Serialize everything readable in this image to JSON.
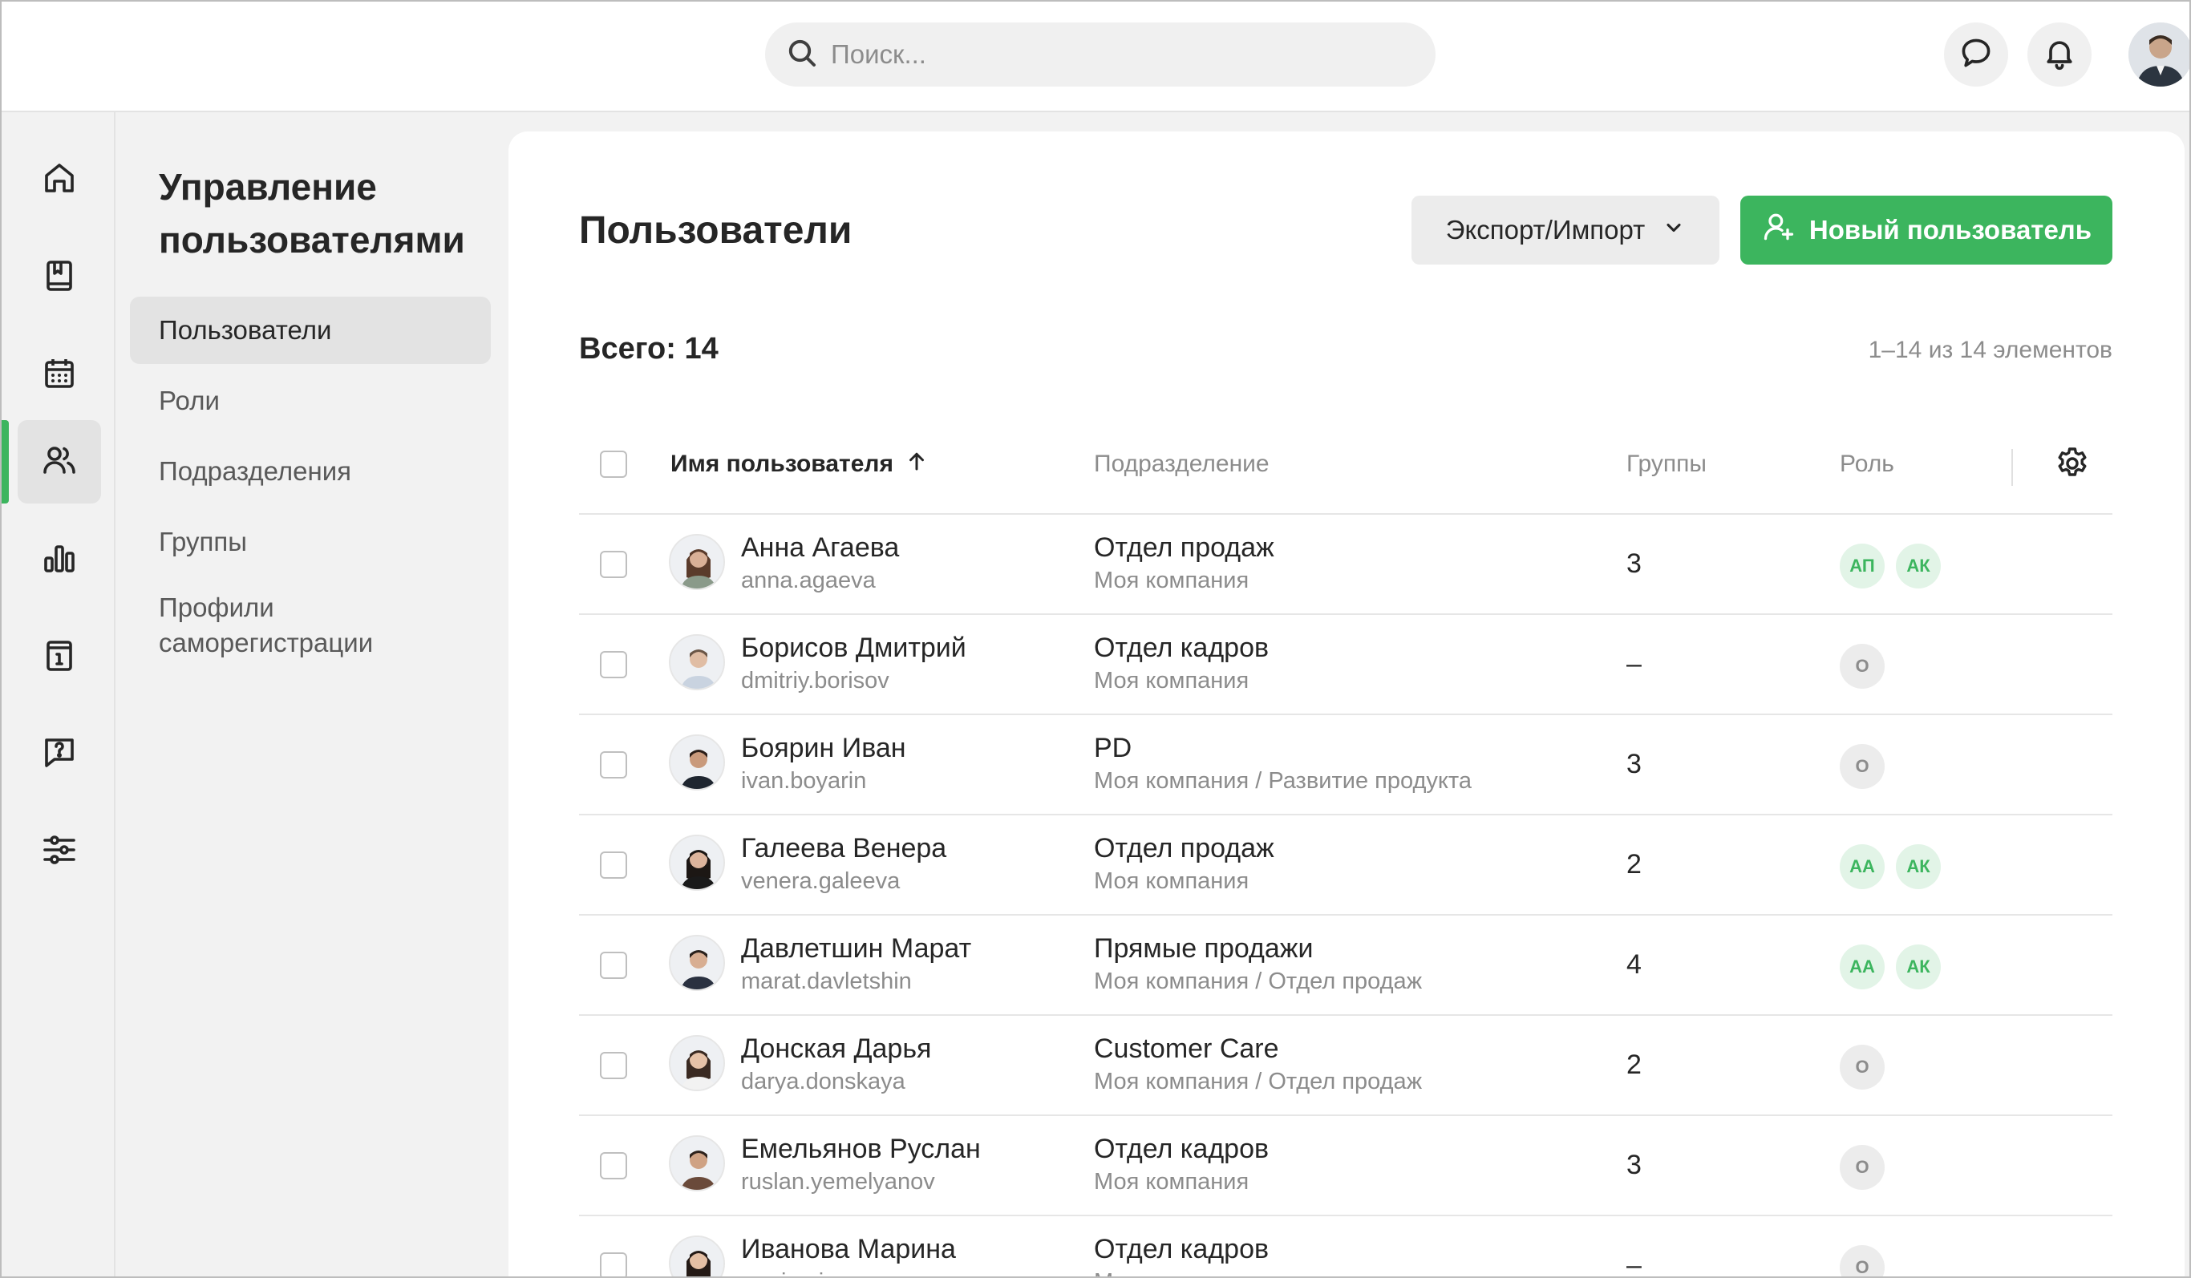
{
  "search": {
    "placeholder": "Поиск..."
  },
  "sidebar": {
    "title": "Управление пользователями",
    "items": [
      {
        "label": "Пользователи",
        "active": true
      },
      {
        "label": "Роли",
        "active": false
      },
      {
        "label": "Подразделения",
        "active": false
      },
      {
        "label": "Группы",
        "active": false
      },
      {
        "label": "Профили саморегистрации",
        "active": false
      }
    ]
  },
  "rail": {
    "icons": [
      "home-icon",
      "book-icon",
      "calendar-icon",
      "users-icon",
      "bar-chart-icon",
      "info-icon",
      "help-message-icon",
      "sliders-icon"
    ],
    "active": "users-icon"
  },
  "main": {
    "title": "Пользователи",
    "export_label": "Экспорт/Импорт",
    "new_user_label": "Новый пользователь",
    "total": "Всего: 14",
    "range": "1–14 из 14 элементов",
    "columns": {
      "name": "Имя пользователя",
      "department": "Подразделение",
      "groups": "Группы",
      "role": "Роль"
    }
  },
  "users": [
    {
      "name": "Анна Агаева",
      "login": "anna.agaeva",
      "dept": "Отдел продаж",
      "path": "Моя компания",
      "groups": "3",
      "roles": [
        "АП",
        "АК"
      ]
    },
    {
      "name": "Борисов Дмитрий",
      "login": "dmitriy.borisov",
      "dept": "Отдел кадров",
      "path": "Моя компания",
      "groups": "–",
      "roles": [
        "О"
      ]
    },
    {
      "name": "Боярин Иван",
      "login": "ivan.boyarin",
      "dept": "PD",
      "path": "Моя компания / Развитие продукта",
      "groups": "3",
      "roles": [
        "О"
      ]
    },
    {
      "name": "Галеева Венера",
      "login": "venera.galeeva",
      "dept": "Отдел продаж",
      "path": "Моя компания",
      "groups": "2",
      "roles": [
        "АА",
        "АК"
      ]
    },
    {
      "name": "Давлетшин Марат",
      "login": "marat.davletshin",
      "dept": "Прямые продажи",
      "path": "Моя компания / Отдел продаж",
      "groups": "4",
      "roles": [
        "АА",
        "АК"
      ]
    },
    {
      "name": "Донская Дарья",
      "login": "darya.donskaya",
      "dept": "Customer Care",
      "path": "Моя компания / Отдел продаж",
      "groups": "2",
      "roles": [
        "О"
      ]
    },
    {
      "name": "Емельянов Руслан",
      "login": "ruslan.yemelyanov",
      "dept": "Отдел кадров",
      "path": "Моя компания",
      "groups": "3",
      "roles": [
        "О"
      ]
    },
    {
      "name": "Иванова Марина",
      "login": "marina.ivanova",
      "dept": "Отдел кадров",
      "path": "Моя компания",
      "groups": "–",
      "roles": [
        "О"
      ]
    }
  ],
  "colors": {
    "accent": "#3cb55e",
    "accent_light": "#e2f4e7",
    "muted": "#8c8c8c"
  }
}
